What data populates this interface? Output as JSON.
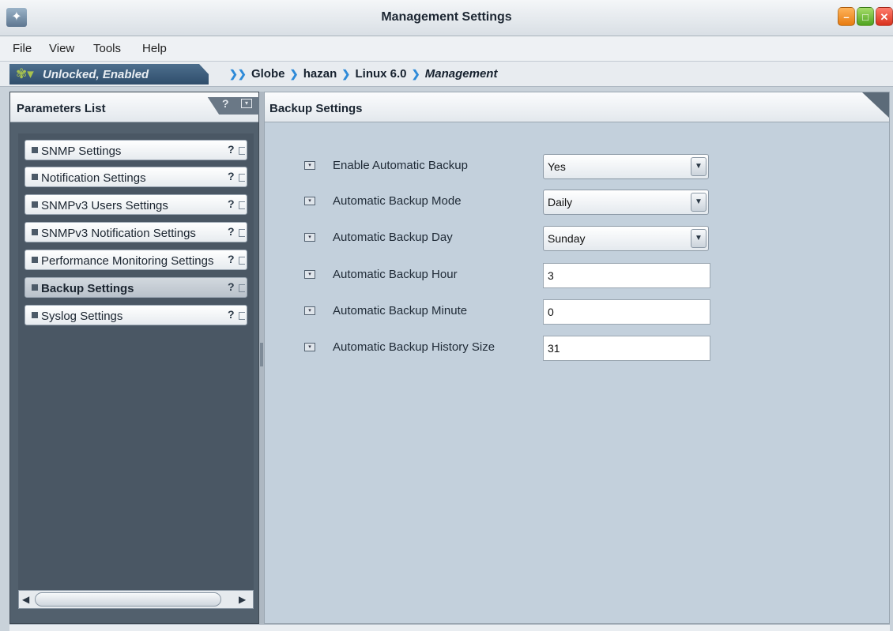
{
  "window": {
    "title": "Management Settings",
    "app_icon": "app-icon",
    "controls": {
      "minimize": "–",
      "maximize": "□",
      "close": "✕"
    }
  },
  "menu": {
    "items": [
      "File",
      "View",
      "Tools",
      "Help"
    ]
  },
  "status": {
    "lock_label": "Unlocked, Enabled",
    "lock_icon": "✾▾",
    "breadcrumb": [
      "Globe",
      "hazan",
      "Linux 6.0",
      "Management"
    ],
    "breadcrumb_sep": "❯"
  },
  "left_panel": {
    "title": "Parameters List",
    "help_glyph": "?",
    "dropdown_glyph": "▾",
    "items": [
      {
        "label": "SNMP Settings",
        "active": false
      },
      {
        "label": "Notification Settings",
        "active": false
      },
      {
        "label": "SNMPv3 Users Settings",
        "active": false
      },
      {
        "label": "SNMPv3 Notification Settings",
        "active": false
      },
      {
        "label": "Performance Monitoring Settings",
        "active": false
      },
      {
        "label": "Backup Settings",
        "active": true
      },
      {
        "label": "Syslog Settings",
        "active": false
      }
    ],
    "item_help": "?",
    "scroll_left": "◀",
    "scroll_right": "▶"
  },
  "right_panel": {
    "title": "Backup Settings",
    "fields": [
      {
        "label": "Enable Automatic Backup",
        "type": "select",
        "value": "Yes"
      },
      {
        "label": "Automatic Backup Mode",
        "type": "select",
        "value": "Daily"
      },
      {
        "label": "Automatic Backup Day",
        "type": "select",
        "value": "Sunday"
      },
      {
        "label": "Automatic Backup Hour",
        "type": "input",
        "value": "3"
      },
      {
        "label": "Automatic Backup Minute",
        "type": "input",
        "value": "0"
      },
      {
        "label": "Automatic Backup History Size",
        "type": "input",
        "value": "31"
      }
    ],
    "field_icon": "▾",
    "select_arrow": "▼"
  }
}
